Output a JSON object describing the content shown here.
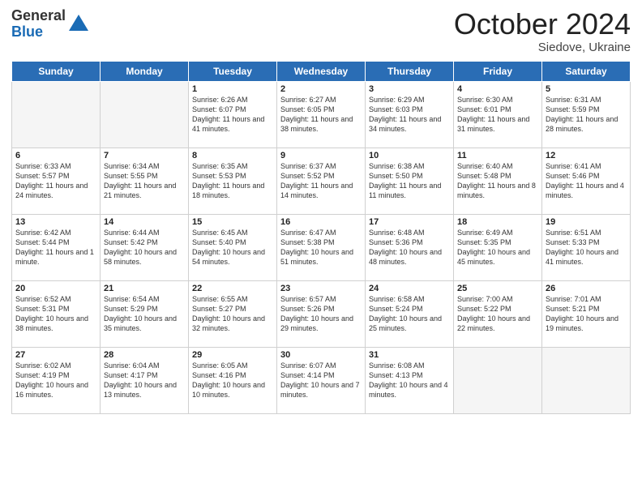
{
  "header": {
    "logo_line1": "General",
    "logo_line2": "Blue",
    "month_title": "October 2024",
    "location": "Siedove, Ukraine"
  },
  "days_of_week": [
    "Sunday",
    "Monday",
    "Tuesday",
    "Wednesday",
    "Thursday",
    "Friday",
    "Saturday"
  ],
  "weeks": [
    [
      {
        "day": "",
        "empty": true
      },
      {
        "day": "",
        "empty": true
      },
      {
        "day": "1",
        "sunrise": "6:26 AM",
        "sunset": "6:07 PM",
        "daylight": "11 hours and 41 minutes."
      },
      {
        "day": "2",
        "sunrise": "6:27 AM",
        "sunset": "6:05 PM",
        "daylight": "11 hours and 38 minutes."
      },
      {
        "day": "3",
        "sunrise": "6:29 AM",
        "sunset": "6:03 PM",
        "daylight": "11 hours and 34 minutes."
      },
      {
        "day": "4",
        "sunrise": "6:30 AM",
        "sunset": "6:01 PM",
        "daylight": "11 hours and 31 minutes."
      },
      {
        "day": "5",
        "sunrise": "6:31 AM",
        "sunset": "5:59 PM",
        "daylight": "11 hours and 28 minutes."
      }
    ],
    [
      {
        "day": "6",
        "sunrise": "6:33 AM",
        "sunset": "5:57 PM",
        "daylight": "11 hours and 24 minutes."
      },
      {
        "day": "7",
        "sunrise": "6:34 AM",
        "sunset": "5:55 PM",
        "daylight": "11 hours and 21 minutes."
      },
      {
        "day": "8",
        "sunrise": "6:35 AM",
        "sunset": "5:53 PM",
        "daylight": "11 hours and 18 minutes."
      },
      {
        "day": "9",
        "sunrise": "6:37 AM",
        "sunset": "5:52 PM",
        "daylight": "11 hours and 14 minutes."
      },
      {
        "day": "10",
        "sunrise": "6:38 AM",
        "sunset": "5:50 PM",
        "daylight": "11 hours and 11 minutes."
      },
      {
        "day": "11",
        "sunrise": "6:40 AM",
        "sunset": "5:48 PM",
        "daylight": "11 hours and 8 minutes."
      },
      {
        "day": "12",
        "sunrise": "6:41 AM",
        "sunset": "5:46 PM",
        "daylight": "11 hours and 4 minutes."
      }
    ],
    [
      {
        "day": "13",
        "sunrise": "6:42 AM",
        "sunset": "5:44 PM",
        "daylight": "11 hours and 1 minute."
      },
      {
        "day": "14",
        "sunrise": "6:44 AM",
        "sunset": "5:42 PM",
        "daylight": "10 hours and 58 minutes."
      },
      {
        "day": "15",
        "sunrise": "6:45 AM",
        "sunset": "5:40 PM",
        "daylight": "10 hours and 54 minutes."
      },
      {
        "day": "16",
        "sunrise": "6:47 AM",
        "sunset": "5:38 PM",
        "daylight": "10 hours and 51 minutes."
      },
      {
        "day": "17",
        "sunrise": "6:48 AM",
        "sunset": "5:36 PM",
        "daylight": "10 hours and 48 minutes."
      },
      {
        "day": "18",
        "sunrise": "6:49 AM",
        "sunset": "5:35 PM",
        "daylight": "10 hours and 45 minutes."
      },
      {
        "day": "19",
        "sunrise": "6:51 AM",
        "sunset": "5:33 PM",
        "daylight": "10 hours and 41 minutes."
      }
    ],
    [
      {
        "day": "20",
        "sunrise": "6:52 AM",
        "sunset": "5:31 PM",
        "daylight": "10 hours and 38 minutes."
      },
      {
        "day": "21",
        "sunrise": "6:54 AM",
        "sunset": "5:29 PM",
        "daylight": "10 hours and 35 minutes."
      },
      {
        "day": "22",
        "sunrise": "6:55 AM",
        "sunset": "5:27 PM",
        "daylight": "10 hours and 32 minutes."
      },
      {
        "day": "23",
        "sunrise": "6:57 AM",
        "sunset": "5:26 PM",
        "daylight": "10 hours and 29 minutes."
      },
      {
        "day": "24",
        "sunrise": "6:58 AM",
        "sunset": "5:24 PM",
        "daylight": "10 hours and 25 minutes."
      },
      {
        "day": "25",
        "sunrise": "7:00 AM",
        "sunset": "5:22 PM",
        "daylight": "10 hours and 22 minutes."
      },
      {
        "day": "26",
        "sunrise": "7:01 AM",
        "sunset": "5:21 PM",
        "daylight": "10 hours and 19 minutes."
      }
    ],
    [
      {
        "day": "27",
        "sunrise": "6:02 AM",
        "sunset": "4:19 PM",
        "daylight": "10 hours and 16 minutes."
      },
      {
        "day": "28",
        "sunrise": "6:04 AM",
        "sunset": "4:17 PM",
        "daylight": "10 hours and 13 minutes."
      },
      {
        "day": "29",
        "sunrise": "6:05 AM",
        "sunset": "4:16 PM",
        "daylight": "10 hours and 10 minutes."
      },
      {
        "day": "30",
        "sunrise": "6:07 AM",
        "sunset": "4:14 PM",
        "daylight": "10 hours and 7 minutes."
      },
      {
        "day": "31",
        "sunrise": "6:08 AM",
        "sunset": "4:13 PM",
        "daylight": "10 hours and 4 minutes."
      },
      {
        "day": "",
        "empty": true
      },
      {
        "day": "",
        "empty": true
      }
    ]
  ]
}
